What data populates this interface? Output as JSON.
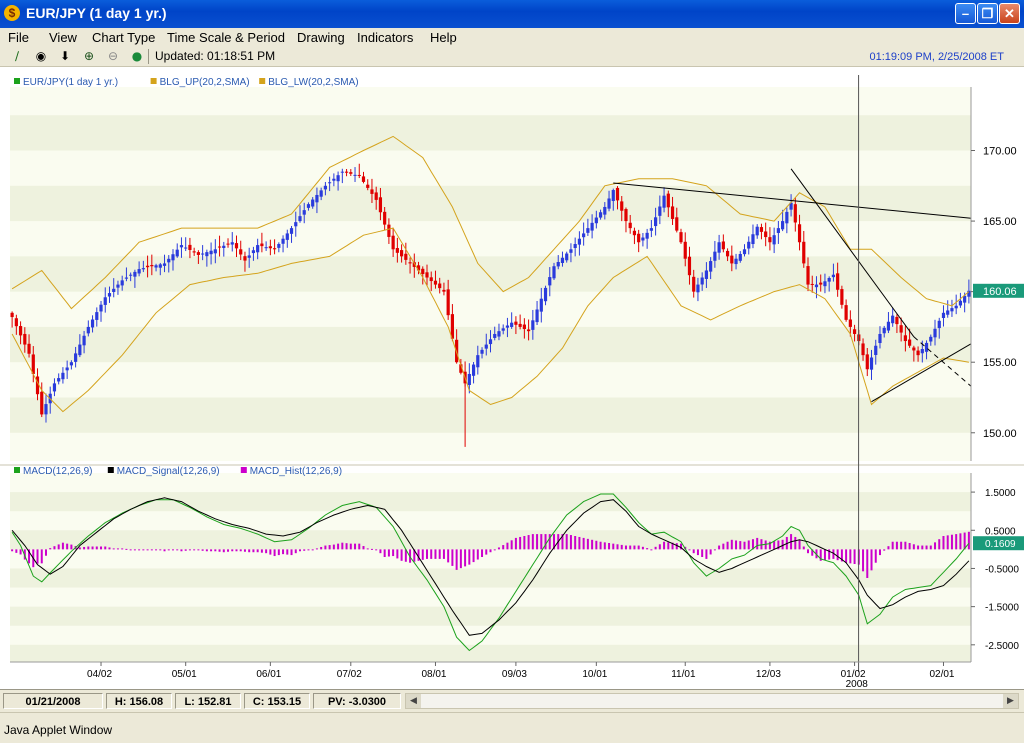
{
  "window": {
    "title": "EUR/JPY (1 day  1 yr.)",
    "app_icon_glyph": "$",
    "buttons": [
      "minimize",
      "maximize",
      "close"
    ]
  },
  "menu": [
    "File",
    "View",
    "Chart Type",
    "Time Scale & Period",
    "Drawing",
    "Indicators",
    "Help"
  ],
  "toolbar": {
    "icons": [
      "draw-line-icon",
      "crosshair-icon",
      "down-arrow-icon",
      "zoom-in-icon",
      "zoom-out-icon",
      "globe-icon"
    ],
    "updated": "Updated: 01:18:51 PM",
    "clock": "01:19:09 PM, 2/25/2008 ET"
  },
  "status": {
    "date": "01/21/2008",
    "high": "H: 156.08",
    "low": "L: 152.81",
    "close": "C: 153.15",
    "pv": "PV: -3.0300"
  },
  "applet_label": "Java Applet Window",
  "colors": {
    "up": "#2a3bdc",
    "down": "#e00000",
    "bollinger": "#d4a31c",
    "macd": "#1ca21c",
    "signal": "#000000",
    "hist": "#cc00cc",
    "price_tag": "#1a9a7a"
  },
  "chart_data": [
    {
      "type": "candlestick",
      "legend": [
        "EUR/JPY(1 day  1 yr.)",
        "BLG_UP(20,2,SMA)",
        "BLG_LW(20,2,SMA)"
      ],
      "ylim": [
        148.0,
        174.5
      ],
      "y_ticks": [
        "170.00",
        "165.00",
        "160.00",
        "155.00",
        "150.00"
      ],
      "y_tick_values": [
        170,
        165,
        160,
        155,
        150
      ],
      "last_price": "160.06",
      "close_anchors": [
        [
          0,
          158.2
        ],
        [
          4,
          155.6
        ],
        [
          7,
          151.3
        ],
        [
          10,
          153.5
        ],
        [
          14,
          155.0
        ],
        [
          18,
          157.5
        ],
        [
          22,
          159.6
        ],
        [
          26,
          160.8
        ],
        [
          30,
          161.6
        ],
        [
          33,
          161.8
        ],
        [
          36,
          162.0
        ],
        [
          40,
          163.3
        ],
        [
          44,
          162.6
        ],
        [
          48,
          163.0
        ],
        [
          52,
          163.5
        ],
        [
          55,
          162.2
        ],
        [
          58,
          163.3
        ],
        [
          62,
          163.0
        ],
        [
          66,
          164.5
        ],
        [
          70,
          166.2
        ],
        [
          74,
          167.5
        ],
        [
          78,
          168.5
        ],
        [
          82,
          168.2
        ],
        [
          86,
          166.5
        ],
        [
          90,
          163.0
        ],
        [
          94,
          162.0
        ],
        [
          98,
          161.0
        ],
        [
          102,
          160.0
        ],
        [
          105,
          155.0
        ],
        [
          107,
          153.5
        ],
        [
          110,
          155.5
        ],
        [
          114,
          157.0
        ],
        [
          118,
          157.8
        ],
        [
          122,
          157.2
        ],
        [
          125,
          159.5
        ],
        [
          128,
          161.8
        ],
        [
          132,
          163.0
        ],
        [
          136,
          164.5
        ],
        [
          140,
          166.0
        ],
        [
          142,
          167.2
        ],
        [
          145,
          165.0
        ],
        [
          148,
          163.5
        ],
        [
          151,
          164.5
        ],
        [
          154,
          166.8
        ],
        [
          158,
          163.5
        ],
        [
          161,
          160.0
        ],
        [
          164,
          161.5
        ],
        [
          167,
          163.5
        ],
        [
          170,
          162.0
        ],
        [
          173,
          163.0
        ],
        [
          176,
          164.6
        ],
        [
          179,
          163.5
        ],
        [
          182,
          165.0
        ],
        [
          184,
          166.3
        ],
        [
          186,
          163.5
        ],
        [
          188,
          160.5
        ],
        [
          191,
          160.5
        ],
        [
          194,
          161.2
        ],
        [
          197,
          158.0
        ],
        [
          200,
          156.5
        ],
        [
          202,
          154.5
        ],
        [
          205,
          157.0
        ],
        [
          208,
          158.3
        ],
        [
          211,
          156.5
        ],
        [
          214,
          155.5
        ],
        [
          217,
          156.8
        ],
        [
          220,
          158.5
        ],
        [
          223,
          159.0
        ],
        [
          226,
          160.06
        ]
      ],
      "bollinger_upper_anchors": [
        [
          0,
          160.2
        ],
        [
          7,
          161.5
        ],
        [
          14,
          158.8
        ],
        [
          22,
          161.0
        ],
        [
          30,
          163.5
        ],
        [
          40,
          164.5
        ],
        [
          50,
          164.5
        ],
        [
          58,
          164.5
        ],
        [
          66,
          165.5
        ],
        [
          75,
          168.8
        ],
        [
          83,
          170.0
        ],
        [
          90,
          171.0
        ],
        [
          97,
          169.5
        ],
        [
          104,
          166.0
        ],
        [
          110,
          162.0
        ],
        [
          116,
          160.0
        ],
        [
          122,
          161.0
        ],
        [
          128,
          163.0
        ],
        [
          134,
          165.0
        ],
        [
          140,
          167.5
        ],
        [
          148,
          168.0
        ],
        [
          156,
          168.0
        ],
        [
          164,
          167.5
        ],
        [
          172,
          165.5
        ],
        [
          180,
          165.0
        ],
        [
          186,
          167.0
        ],
        [
          192,
          166.0
        ],
        [
          198,
          163.0
        ],
        [
          203,
          163.0
        ],
        [
          210,
          161.0
        ],
        [
          216,
          159.5
        ],
        [
          222,
          159.0
        ],
        [
          226,
          160.0
        ]
      ],
      "bollinger_lower_anchors": [
        [
          0,
          157.0
        ],
        [
          7,
          153.0
        ],
        [
          12,
          151.5
        ],
        [
          18,
          153.0
        ],
        [
          26,
          155.5
        ],
        [
          34,
          158.5
        ],
        [
          42,
          160.5
        ],
        [
          50,
          161.0
        ],
        [
          58,
          161.3
        ],
        [
          66,
          162.0
        ],
        [
          75,
          162.5
        ],
        [
          83,
          164.0
        ],
        [
          90,
          164.5
        ],
        [
          97,
          161.0
        ],
        [
          103,
          157.5
        ],
        [
          108,
          153.0
        ],
        [
          113,
          152.0
        ],
        [
          118,
          152.5
        ],
        [
          124,
          154.0
        ],
        [
          130,
          156.0
        ],
        [
          136,
          159.0
        ],
        [
          142,
          161.0
        ],
        [
          150,
          162.5
        ],
        [
          158,
          159.0
        ],
        [
          165,
          158.0
        ],
        [
          172,
          159.0
        ],
        [
          180,
          160.0
        ],
        [
          186,
          160.5
        ],
        [
          192,
          159.5
        ],
        [
          198,
          157.0
        ],
        [
          203,
          152.0
        ],
        [
          208,
          153.3
        ],
        [
          214,
          154.3
        ],
        [
          220,
          155.3
        ],
        [
          226,
          155.0
        ]
      ]
    },
    {
      "type": "line",
      "legend": [
        "MACD(12,26,9)",
        "MACD_Signal(12,26,9)",
        "MACD_Hist(12,26,9)"
      ],
      "ylim": [
        -2.95,
        2.0
      ],
      "y_ticks": [
        "1.5000",
        "0.5000",
        "-0.5000",
        "-1.5000",
        "-2.5000"
      ],
      "y_tick_values": [
        1.5,
        0.5,
        -0.5,
        -1.5,
        -2.5
      ],
      "last_value": "0.1609",
      "macd_anchors": [
        [
          0,
          0.45
        ],
        [
          2,
          0.1
        ],
        [
          5,
          -0.7
        ],
        [
          7,
          -0.85
        ],
        [
          10,
          -0.5
        ],
        [
          14,
          -0.05
        ],
        [
          18,
          0.35
        ],
        [
          22,
          0.7
        ],
        [
          26,
          0.95
        ],
        [
          30,
          1.15
        ],
        [
          34,
          1.3
        ],
        [
          38,
          1.3
        ],
        [
          42,
          1.1
        ],
        [
          46,
          0.85
        ],
        [
          50,
          0.65
        ],
        [
          54,
          0.55
        ],
        [
          58,
          0.4
        ],
        [
          62,
          0.2
        ],
        [
          66,
          0.25
        ],
        [
          70,
          0.55
        ],
        [
          74,
          0.9
        ],
        [
          78,
          1.15
        ],
        [
          82,
          1.25
        ],
        [
          86,
          1.1
        ],
        [
          90,
          0.6
        ],
        [
          94,
          -0.2
        ],
        [
          98,
          -0.8
        ],
        [
          102,
          -1.5
        ],
        [
          105,
          -2.3
        ],
        [
          108,
          -2.65
        ],
        [
          111,
          -2.4
        ],
        [
          115,
          -1.8
        ],
        [
          119,
          -1.1
        ],
        [
          123,
          -0.4
        ],
        [
          127,
          0.3
        ],
        [
          131,
          0.9
        ],
        [
          135,
          1.25
        ],
        [
          139,
          1.45
        ],
        [
          142,
          1.45
        ],
        [
          145,
          1.1
        ],
        [
          148,
          0.7
        ],
        [
          151,
          0.4
        ],
        [
          154,
          0.45
        ],
        [
          158,
          0.2
        ],
        [
          161,
          -0.35
        ],
        [
          164,
          -0.7
        ],
        [
          167,
          -0.5
        ],
        [
          170,
          -0.25
        ],
        [
          173,
          -0.15
        ],
        [
          176,
          0.1
        ],
        [
          179,
          0.15
        ],
        [
          182,
          0.35
        ],
        [
          184,
          0.6
        ],
        [
          186,
          0.5
        ],
        [
          188,
          0.1
        ],
        [
          191,
          -0.25
        ],
        [
          194,
          -0.35
        ],
        [
          197,
          -0.7
        ],
        [
          200,
          -1.2
        ],
        [
          202,
          -1.95
        ],
        [
          205,
          -1.7
        ],
        [
          208,
          -1.25
        ],
        [
          211,
          -1.05
        ],
        [
          214,
          -1.0
        ],
        [
          217,
          -0.95
        ],
        [
          220,
          -0.6
        ],
        [
          223,
          -0.25
        ],
        [
          226,
          0.16
        ]
      ],
      "signal_anchors": [
        [
          0,
          0.5
        ],
        [
          3,
          0.1
        ],
        [
          6,
          -0.4
        ],
        [
          9,
          -0.65
        ],
        [
          12,
          -0.45
        ],
        [
          16,
          0.1
        ],
        [
          20,
          0.45
        ],
        [
          24,
          0.8
        ],
        [
          28,
          1.05
        ],
        [
          32,
          1.25
        ],
        [
          36,
          1.35
        ],
        [
          40,
          1.25
        ],
        [
          44,
          1.0
        ],
        [
          48,
          0.8
        ],
        [
          52,
          0.65
        ],
        [
          56,
          0.55
        ],
        [
          60,
          0.4
        ],
        [
          64,
          0.35
        ],
        [
          68,
          0.45
        ],
        [
          72,
          0.7
        ],
        [
          76,
          0.9
        ],
        [
          80,
          1.05
        ],
        [
          84,
          1.15
        ],
        [
          88,
          1.05
        ],
        [
          92,
          0.5
        ],
        [
          96,
          -0.2
        ],
        [
          100,
          -0.9
        ],
        [
          104,
          -1.6
        ],
        [
          108,
          -2.25
        ],
        [
          111,
          -2.2
        ],
        [
          115,
          -1.85
        ],
        [
          119,
          -1.4
        ],
        [
          123,
          -0.8
        ],
        [
          127,
          -0.1
        ],
        [
          131,
          0.5
        ],
        [
          135,
          0.95
        ],
        [
          139,
          1.25
        ],
        [
          142,
          1.3
        ],
        [
          145,
          1.0
        ],
        [
          148,
          0.6
        ],
        [
          151,
          0.4
        ],
        [
          154,
          0.25
        ],
        [
          158,
          0.05
        ],
        [
          161,
          -0.25
        ],
        [
          164,
          -0.45
        ],
        [
          167,
          -0.6
        ],
        [
          170,
          -0.5
        ],
        [
          173,
          -0.35
        ],
        [
          176,
          -0.2
        ],
        [
          179,
          -0.05
        ],
        [
          182,
          0.1
        ],
        [
          184,
          0.2
        ],
        [
          186,
          0.25
        ],
        [
          188,
          0.2
        ],
        [
          191,
          0.05
        ],
        [
          194,
          -0.1
        ],
        [
          197,
          -0.35
        ],
        [
          200,
          -0.8
        ],
        [
          202,
          -1.2
        ],
        [
          205,
          -1.55
        ],
        [
          208,
          -1.45
        ],
        [
          211,
          -1.25
        ],
        [
          214,
          -1.1
        ],
        [
          217,
          -1.05
        ],
        [
          220,
          -0.95
        ],
        [
          223,
          -0.65
        ],
        [
          226,
          -0.3
        ]
      ]
    },
    {
      "type": "axis",
      "x_ticks": [
        "04/02",
        "05/01",
        "06/01",
        "07/02",
        "08/01",
        "09/03",
        "10/01",
        "11/01",
        "12/03",
        "01/02",
        "02/01"
      ],
      "x_tick_index": [
        21,
        41,
        61,
        80,
        100,
        119,
        138,
        159,
        179,
        199,
        220
      ],
      "year_label": "2008",
      "year_label_index": 199
    }
  ]
}
